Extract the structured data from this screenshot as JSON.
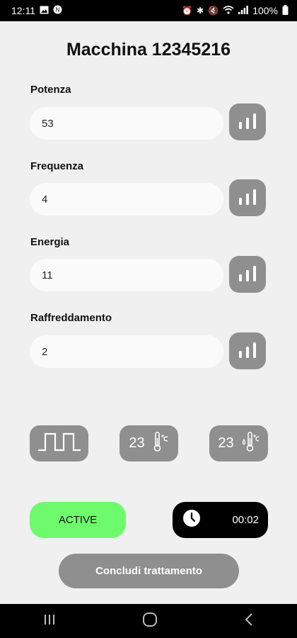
{
  "status_bar": {
    "time": "12:11",
    "battery": "100%",
    "left_icons": [
      "image-icon",
      "notification-icon"
    ],
    "right_icons": [
      "alarm-icon",
      "bluetooth-icon",
      "mute-icon",
      "wifi-icon",
      "signal-icon",
      "battery-icon"
    ]
  },
  "title": "Macchina 12345216",
  "params": [
    {
      "label": "Potenza",
      "value": "53",
      "button_icon": "signal-bars-icon"
    },
    {
      "label": "Frequenza",
      "value": "4",
      "button_icon": "signal-bars-icon"
    },
    {
      "label": "Energia",
      "value": "11",
      "button_icon": "signal-bars-icon"
    },
    {
      "label": "Raffreddamento",
      "value": "2",
      "button_icon": "signal-bars-icon"
    }
  ],
  "modes": {
    "pulse_icon": "square-wave-icon",
    "temp1_value": "23",
    "temp1_icon": "thermometer-celsius-icon",
    "temp2_value": "23",
    "temp2_icon": "thermometer-drop-icon"
  },
  "status": {
    "active_label": "ACTIVE"
  },
  "timer": {
    "value": "00:02",
    "icon": "clock-icon"
  },
  "end_button": "Concludi trattamento",
  "nav": {
    "icons": [
      "recents-icon",
      "home-icon",
      "back-icon"
    ]
  },
  "colors": {
    "active_green": "#6dfb6d",
    "button_gray": "#8f8f8f",
    "timer_bg": "#000000"
  }
}
